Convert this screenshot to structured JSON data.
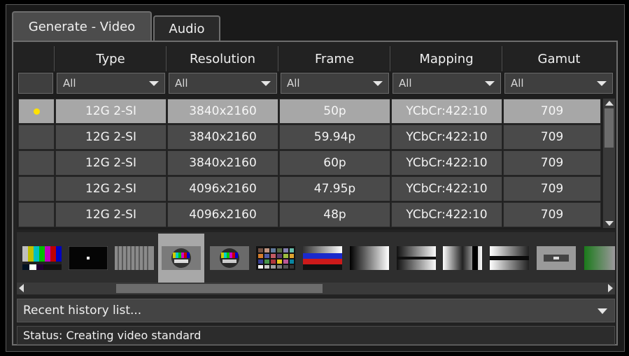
{
  "tabs": [
    {
      "label": "Generate - Video",
      "active": true
    },
    {
      "label": "Audio",
      "active": false
    }
  ],
  "table": {
    "columns": [
      "Type",
      "Resolution",
      "Frame",
      "Mapping",
      "Gamut"
    ],
    "filters": [
      "All",
      "All",
      "All",
      "All",
      "All"
    ],
    "rows": [
      {
        "selected": true,
        "cells": [
          "12G 2-SI",
          "3840x2160",
          "50p",
          "YCbCr:422:10",
          "709"
        ]
      },
      {
        "selected": false,
        "cells": [
          "12G 2-SI",
          "3840x2160",
          "59.94p",
          "YCbCr:422:10",
          "709"
        ]
      },
      {
        "selected": false,
        "cells": [
          "12G 2-SI",
          "3840x2160",
          "60p",
          "YCbCr:422:10",
          "709"
        ]
      },
      {
        "selected": false,
        "cells": [
          "12G 2-SI",
          "4096x2160",
          "47.95p",
          "YCbCr:422:10",
          "709"
        ]
      },
      {
        "selected": false,
        "cells": [
          "12G 2-SI",
          "4096x2160",
          "48p",
          "YCbCr:422:10",
          "709"
        ]
      }
    ]
  },
  "patterns": [
    {
      "icon": "smpte-color-bars-icon"
    },
    {
      "icon": "pluge-dot-icon"
    },
    {
      "icon": "gray-stripes-icon"
    },
    {
      "icon": "circle-test-chart-icon",
      "selected": true
    },
    {
      "icon": "circle-test-chart-alt-icon"
    },
    {
      "icon": "color-checker-icon"
    },
    {
      "icon": "tricolor-bars-icon"
    },
    {
      "icon": "horizontal-gradient-icon"
    },
    {
      "icon": "ramp-gradient-icon"
    },
    {
      "icon": "split-gradient-icon"
    },
    {
      "icon": "stair-gradient-icon"
    },
    {
      "icon": "gray-window-icon"
    },
    {
      "icon": "green-gradient-icon"
    }
  ],
  "history": {
    "label": "Recent history list..."
  },
  "status": {
    "text": "Status: Creating video standard"
  },
  "colors": {
    "selected_row": "#a7a7a7",
    "row": "#4a4a4a",
    "indicator": "#ffe200"
  }
}
